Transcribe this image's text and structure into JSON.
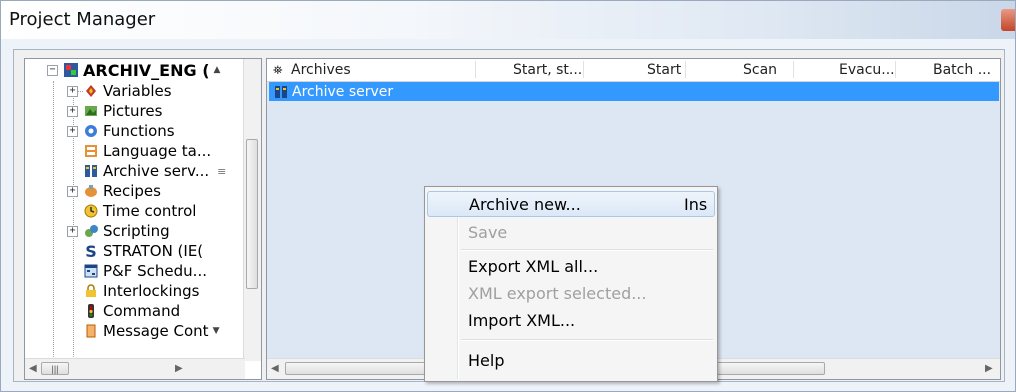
{
  "window": {
    "title": "Project Manager"
  },
  "tree": {
    "items": [
      {
        "label": "ARCHIV_ENG (",
        "icon": "project-icon"
      },
      {
        "label": "Variables",
        "icon": "variables-icon"
      },
      {
        "label": "Pictures",
        "icon": "pictures-icon"
      },
      {
        "label": "Functions",
        "icon": "functions-icon"
      },
      {
        "label": "Language ta...",
        "icon": "language-table-icon"
      },
      {
        "label": "Archive serv...",
        "icon": "archive-server-icon"
      },
      {
        "label": "Recipes",
        "icon": "recipes-icon"
      },
      {
        "label": "Time control",
        "icon": "time-control-icon"
      },
      {
        "label": "Scripting",
        "icon": "scripting-icon"
      },
      {
        "label": "STRATON (IE(",
        "icon": "straton-icon"
      },
      {
        "label": "P&F Schedu...",
        "icon": "pf-scheduler-icon"
      },
      {
        "label": "Interlockings",
        "icon": "interlockings-icon"
      },
      {
        "label": "Command",
        "icon": "command-icon"
      },
      {
        "label": "Message Cont",
        "icon": "message-control-icon"
      }
    ]
  },
  "list": {
    "columns": [
      "Archives",
      "Start, st...",
      "Start",
      "Scan",
      "Evacu...",
      "Batch ..."
    ],
    "rows": [
      {
        "name": "Archive server"
      }
    ]
  },
  "context_menu": {
    "items": [
      {
        "label": "Archive new...",
        "shortcut": "Ins",
        "enabled": true,
        "highlighted": true
      },
      {
        "label": "Save",
        "enabled": false
      },
      {
        "label": "Export XML all...",
        "enabled": true
      },
      {
        "label": "XML export selected...",
        "enabled": false
      },
      {
        "label": "Import XML...",
        "enabled": true
      },
      {
        "label": "Help",
        "enabled": true
      }
    ]
  },
  "colors": {
    "selection": "#3399ff",
    "list_background": "#dde6f3",
    "disabled_text": "#a0a0a0"
  }
}
